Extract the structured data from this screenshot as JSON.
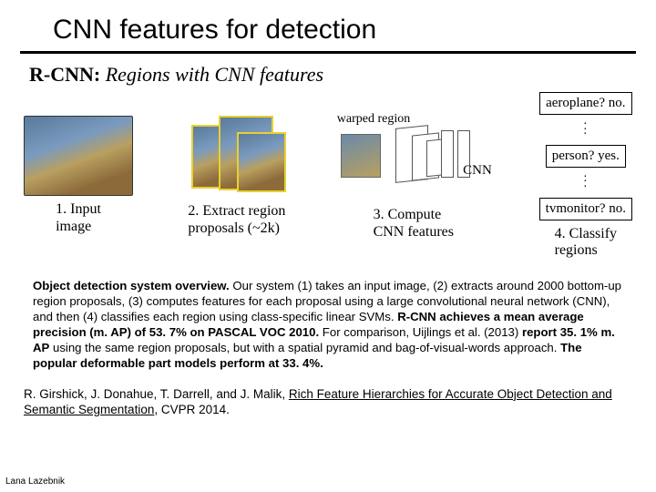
{
  "title": "CNN features for detection",
  "fig": {
    "title_bold": "R-CNN:",
    "title_ital": "Regions with CNN features",
    "warp_label": "warped region",
    "cnn_label": "CNN",
    "stage1": {
      "num": "1.",
      "l1": "Input",
      "l2": "image"
    },
    "stage2": {
      "num": "2.",
      "l1": "Extract region",
      "l2": "proposals (~2k)"
    },
    "stage3": {
      "num": "3.",
      "l1": "Compute",
      "l2": "CNN features"
    },
    "stage4": {
      "num": "4.",
      "l1": "Classify",
      "l2": "regions"
    },
    "cls": {
      "a": "aeroplane? no.",
      "b": "person? yes.",
      "c": "tvmonitor? no."
    }
  },
  "caption": {
    "lead_b": "Object detection system overview.",
    "p1": " Our system (1) takes an input image, (2) extracts around 2000 bottom-up region proposals, (3) computes features for each proposal using a large convolutional neural network (CNN), and then (4) classifies each region using class-specific linear SVMs. ",
    "b2": "R-CNN achieves a mean average precision (m. AP) of 53. 7% on PASCAL VOC 2010.",
    "p2": " For comparison, Uijlings et al. (2013) ",
    "b3": "report 35. 1% m. AP",
    "p3": " using the same region proposals, but with a spatial pyramid and bag-of-visual-words approach. ",
    "b4": "The popular deformable part models perform at 33. 4%."
  },
  "cite": {
    "authors": "R. Girshick, J. Donahue, T. Darrell, and J. Malik, ",
    "title_u": "Rich Feature Hierarchies for Accurate Object Detection and Semantic Segmentation",
    "venue": ", CVPR 2014."
  },
  "footer": "Lana Lazebnik"
}
